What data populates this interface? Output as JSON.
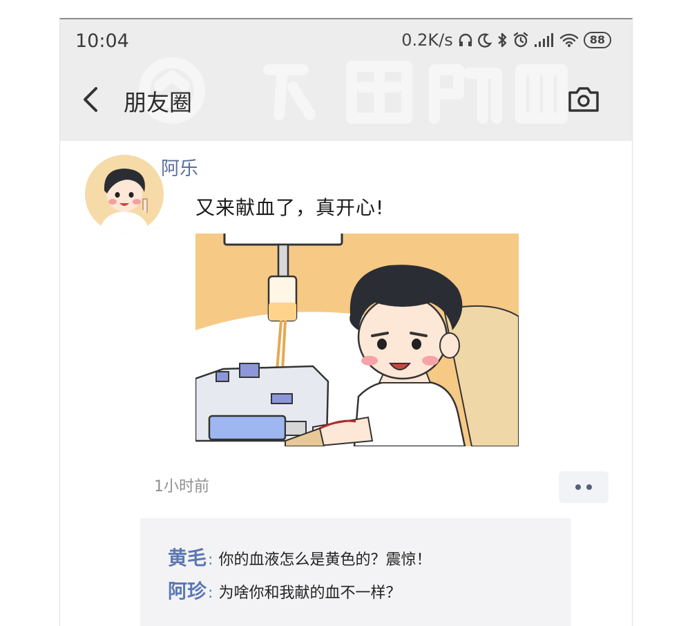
{
  "status_bar": {
    "time": "10:04",
    "network_speed": "0.2K/s",
    "battery": "88",
    "icons": [
      "headphones-icon",
      "moon-icon",
      "bluetooth-icon",
      "alarm-icon",
      "signal-icon",
      "wifi-icon",
      "battery-icon"
    ]
  },
  "nav": {
    "back_icon": "back-chevron-icon",
    "title": "朋友圈",
    "camera_icon": "camera-icon"
  },
  "post": {
    "author": "阿乐",
    "text": "又来献血了，真开心!",
    "image_alt": "cartoon boy donating blood",
    "time_ago": "1小时前",
    "more_icon": "more-dots-icon",
    "comments": [
      {
        "author": "黄毛",
        "text": "你的血液怎么是黄色的？震惊！"
      },
      {
        "author": "阿珍",
        "text": "为啥你和我献的血不一样？"
      }
    ]
  },
  "colors": {
    "topbar_bg": "#ededed",
    "name_link": "#5b6f9b",
    "comment_author": "#5b78b4",
    "comment_bg": "#f3f3f5",
    "photo_bg": "#f6c985"
  }
}
